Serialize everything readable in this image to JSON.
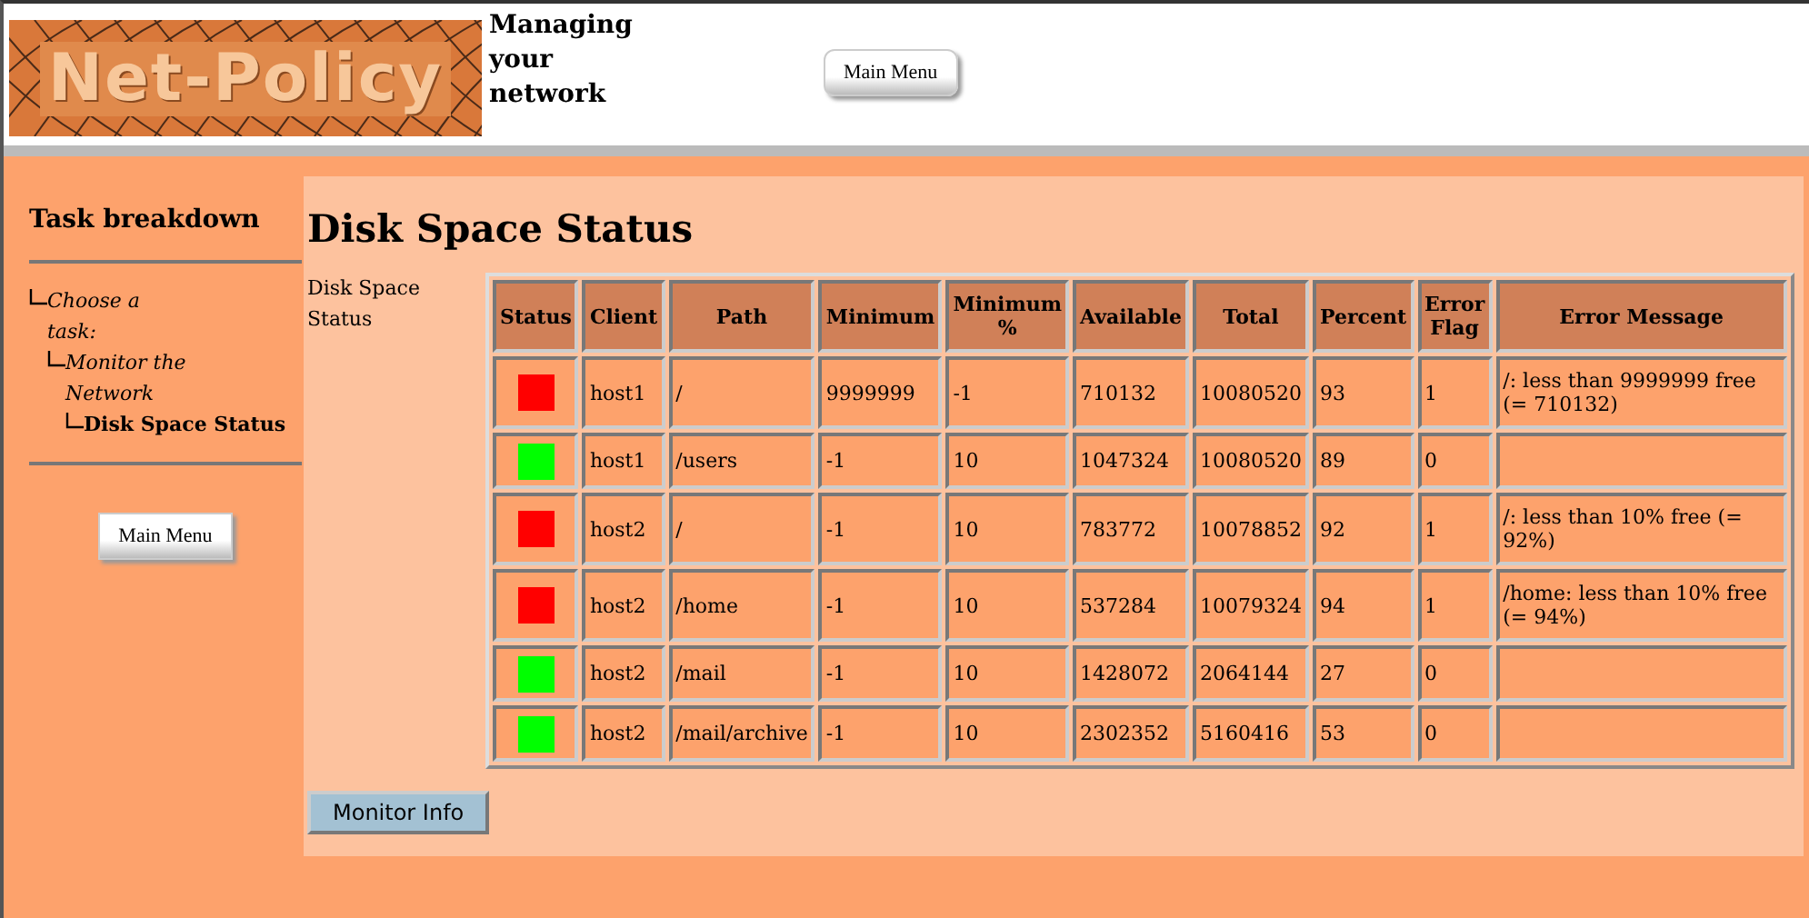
{
  "header": {
    "logo": "Net-Policy",
    "tagline": "Managing your network",
    "menu_button": "Main Menu"
  },
  "sidebar": {
    "title": "Task breakdown",
    "tree": [
      {
        "label": "Choose a task:",
        "current": false,
        "children": [
          {
            "label": "Monitor the Network",
            "current": false,
            "children": [
              {
                "label": "Disk Space Status",
                "current": true
              }
            ]
          }
        ]
      }
    ],
    "menu_button": "Main Menu"
  },
  "main": {
    "title": "Disk Space Status",
    "side_label": "Disk Space Status",
    "table": {
      "columns": [
        "Status",
        "Client",
        "Path",
        "Minimum",
        "Minimum %",
        "Available",
        "Total",
        "Percent",
        "Error Flag",
        "Error Message"
      ],
      "rows": [
        {
          "color": "#ff0000",
          "cells": [
            "",
            "host1",
            "/",
            "9999999",
            "-1",
            "710132",
            "10080520",
            "93",
            "1",
            "/: less than 9999999 free (= 710132)"
          ]
        },
        {
          "color": "#00ff00",
          "cells": [
            "",
            "host1",
            "/users",
            "-1",
            "10",
            "1047324",
            "10080520",
            "89",
            "0",
            ""
          ]
        },
        {
          "color": "#ff0000",
          "cells": [
            "",
            "host2",
            "/",
            "-1",
            "10",
            "783772",
            "10078852",
            "92",
            "1",
            "/: less than 10% free (= 92%)"
          ]
        },
        {
          "color": "#ff0000",
          "cells": [
            "",
            "host2",
            "/home",
            "-1",
            "10",
            "537284",
            "10079324",
            "94",
            "1",
            "/home: less than 10% free (= 94%)"
          ]
        },
        {
          "color": "#00ff00",
          "cells": [
            "",
            "host2",
            "/mail",
            "-1",
            "10",
            "1428072",
            "2064144",
            "27",
            "0",
            ""
          ]
        },
        {
          "color": "#00ff00",
          "cells": [
            "",
            "host2",
            "/mail/archive",
            "-1",
            "10",
            "2302352",
            "5160416",
            "53",
            "0",
            ""
          ]
        }
      ]
    },
    "button": "Monitor Info"
  }
}
